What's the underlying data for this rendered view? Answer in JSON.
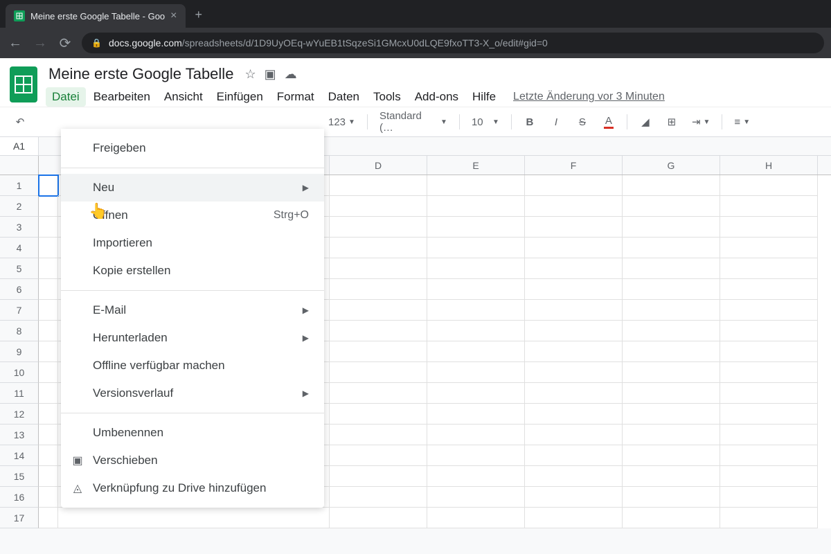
{
  "browser": {
    "tab_title": "Meine erste Google Tabelle - Goo",
    "url_host": "docs.google.com",
    "url_path": "/spreadsheets/d/1D9UyOEq-wYuEB1tSqzeSi1GMcxU0dLQE9fxoTT3-X_o/edit#gid=0"
  },
  "doc": {
    "title": "Meine erste Google Tabelle",
    "last_edit": "Letzte Änderung vor 3 Minuten"
  },
  "menubar": [
    "Datei",
    "Bearbeiten",
    "Ansicht",
    "Einfügen",
    "Format",
    "Daten",
    "Tools",
    "Add-ons",
    "Hilfe"
  ],
  "toolbar": {
    "format_number": "123",
    "font": "Standard (…",
    "font_size": "10"
  },
  "namebox": "A1",
  "columns": [
    "D",
    "E",
    "F",
    "G",
    "H"
  ],
  "row_count": 17,
  "file_menu": {
    "groups": [
      [
        {
          "label": "Freigeben"
        }
      ],
      [
        {
          "label": "Neu",
          "submenu": true,
          "hover": true
        },
        {
          "label": "Öffnen",
          "shortcut": "Strg+O"
        },
        {
          "label": "Importieren"
        },
        {
          "label": "Kopie erstellen"
        }
      ],
      [
        {
          "label": "E-Mail",
          "submenu": true
        },
        {
          "label": "Herunterladen",
          "submenu": true
        },
        {
          "label": "Offline verfügbar machen"
        },
        {
          "label": "Versionsverlauf",
          "submenu": true
        }
      ],
      [
        {
          "label": "Umbenennen"
        },
        {
          "label": "Verschieben",
          "icon": "folder"
        },
        {
          "label": "Verknüpfung zu Drive hinzufügen",
          "icon": "drive"
        }
      ]
    ]
  }
}
